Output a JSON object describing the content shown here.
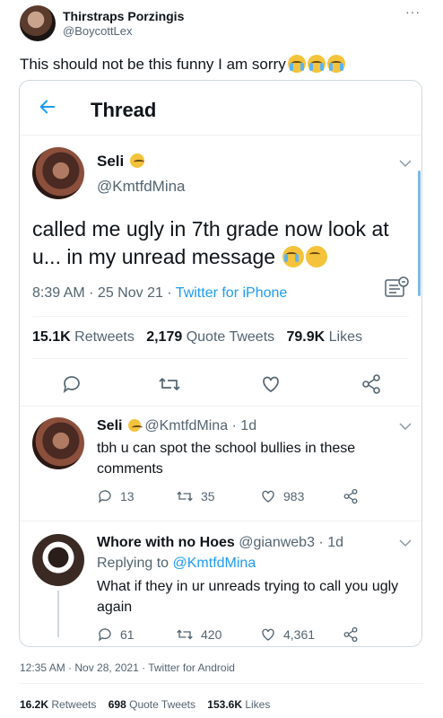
{
  "tweet": {
    "author_name": "Thirstraps Porzingis",
    "author_handle": "@BoycottLex",
    "text": "This should not be this funny I am sorry",
    "footer": "12:35 AM · Nov 28, 2021 · Twitter for Android",
    "stats": {
      "retweets_count": "16.2K",
      "retweets_label": "Retweets",
      "quotes_count": "698",
      "quotes_label": "Quote Tweets",
      "likes_count": "153.6K",
      "likes_label": "Likes"
    }
  },
  "screenshot": {
    "header_title": "Thread",
    "main": {
      "name": "Seli",
      "handle": "@KmtfdMina",
      "text": "called me ugly in 7th grade now look at u... in my unread message",
      "time": "8:39 AM · 25 Nov 21 · ",
      "source": "Twitter for iPhone",
      "retweets_count": "15.1K",
      "retweets_label": "Retweets",
      "quotes_count": "2,179",
      "quotes_label": "Quote Tweets",
      "likes_count": "79.9K",
      "likes_label": "Likes"
    },
    "replies": [
      {
        "name": "Seli",
        "handle": "@KmtfdMina · 1d",
        "text": "tbh u can spot the school bullies in these comments",
        "replies": "13",
        "retweets": "35",
        "likes": "983"
      },
      {
        "name": "Whore with no Hoes",
        "handle": "@gianweb3 · 1d",
        "replying_prefix": "Replying to ",
        "replying_to": "@KmtfdMina",
        "text": "What if they in ur unreads trying to call you ugly again",
        "replies": "61",
        "retweets": "420",
        "likes": "4,361"
      }
    ]
  },
  "colors": {
    "accent": "#1d9bf0",
    "secondary_text": "#536471",
    "primary_text": "#0f1419",
    "border": "#cfd9de"
  }
}
